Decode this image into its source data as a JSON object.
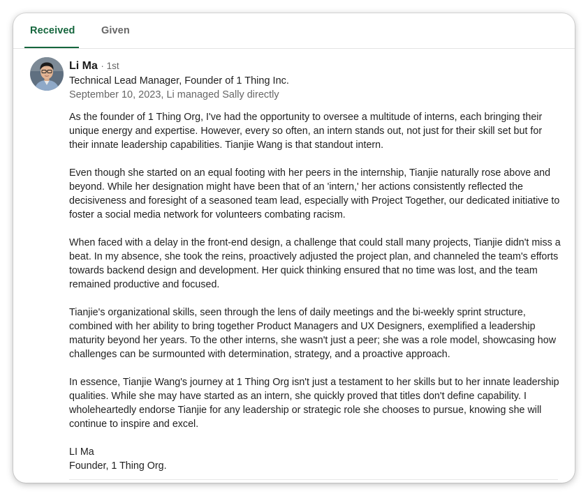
{
  "tabs": {
    "received": "Received",
    "given": "Given",
    "active": "Received",
    "accent_color": "#15663d"
  },
  "recommender": {
    "name": "Li Ma",
    "degree": "· 1st",
    "headline": "Technical Lead Manager, Founder of 1 Thing Inc.",
    "meta": "September 10, 2023, Li managed Sally directly",
    "avatar_icon": "profile-photo"
  },
  "recommendation": {
    "paragraphs": [
      "As the founder of 1 Thing Org, I've had the opportunity to oversee a multitude of interns, each bringing their unique energy and expertise. However, every so often, an intern stands out, not just for their skill set but for their innate leadership capabilities. Tianjie Wang is that standout intern.",
      "Even though she started on an equal footing with her peers in the internship, Tianjie naturally rose above and beyond. While her designation might have been that of an 'intern,' her actions consistently reflected the decisiveness and foresight of a seasoned team lead, especially with Project Together, our dedicated initiative to foster a social media network for volunteers combating racism.",
      "When faced with a delay in the front-end design, a challenge that could stall many projects, Tianjie didn't miss a beat. In my absence, she took the reins, proactively adjusted the project plan, and channeled the team's efforts towards backend design and development. Her quick thinking ensured that no time was lost, and the team remained productive and focused.",
      "Tianjie's organizational skills, seen through the lens of daily meetings and the bi-weekly sprint structure, combined with her ability to bring together Product Managers and UX Designers, exemplified a leadership maturity beyond her years. To the other interns, she wasn't just a peer; she was a role model, showcasing how challenges can be surmounted with determination, strategy, and a proactive approach.",
      "In essence, Tianjie Wang's journey at 1 Thing Org isn't just a testament to her skills but to her innate leadership qualities. While she may have started as an intern, she quickly proved that titles don't define capability. I wholeheartedly endorse Tianjie for any leadership or strategic role she chooses to pursue, knowing she will continue to inspire and excel."
    ],
    "signature_name": "LI Ma",
    "signature_title": "Founder, 1 Thing Org."
  }
}
